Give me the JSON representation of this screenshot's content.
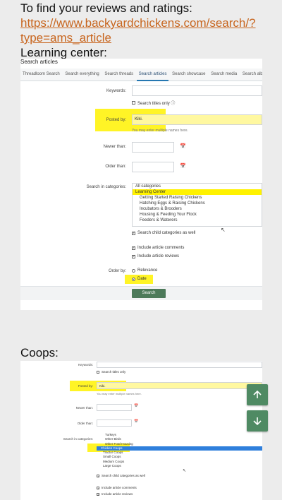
{
  "intro": {
    "line1": "To find your reviews and ratings:",
    "link_line1": "https://www.backyardchickens.com/search/?",
    "link_line2": "type=ams_article",
    "section1": "Learning center:",
    "section2": "Coops:"
  },
  "shot1": {
    "title": "Search articles",
    "tabs": [
      "Threadloom Search",
      "Search everything",
      "Search threads",
      "Search articles",
      "Search showcase",
      "Search media",
      "Search album"
    ],
    "keywords_label": "Keywords:",
    "titles_only": "Search titles only ⓘ",
    "posted_by_label": "Posted by:",
    "posted_by_value": "Kiki.",
    "names_hint": "You may enter multiple names here.",
    "newer_label": "Newer than:",
    "older_label": "Older than:",
    "categories_label": "Search in categories:",
    "categories": [
      {
        "label": "All categories",
        "level": "top",
        "state": ""
      },
      {
        "label": "Learning Center",
        "level": "top",
        "state": "sel"
      },
      {
        "label": "Getting Started Raising Chickens",
        "level": "sub",
        "state": ""
      },
      {
        "label": "Hatching Eggs & Raising Chickens",
        "level": "sub",
        "state": ""
      },
      {
        "label": "Incubators & Brooders",
        "level": "sub",
        "state": ""
      },
      {
        "label": "Housing & Feeding Your Flock",
        "level": "sub",
        "state": ""
      },
      {
        "label": "Feeders & Waterers",
        "level": "sub",
        "state": ""
      }
    ],
    "child_cats": "Search child categories as well",
    "include_comments": "Include article comments",
    "include_reviews": "Include article reviews",
    "order_label": "Order by:",
    "order_relevance": "Relevance",
    "order_date": "Date",
    "search_button": "Search"
  },
  "shot2": {
    "keywords_label": "Keywords:",
    "titles_only": "Search titles only",
    "posted_by_label": "Posted by:",
    "posted_by_value": "Kiki.",
    "names_hint": "You may enter multiple names here.",
    "newer_label": "Newer than:",
    "older_label": "Older than:",
    "categories_label": "Search in categories:",
    "categories": [
      {
        "label": "Turkeys",
        "state": ""
      },
      {
        "label": "Other Birds",
        "state": ""
      },
      {
        "label": "Other Fowl Housing",
        "state": ""
      },
      {
        "label": "Chicken Coops",
        "state": "sel2"
      },
      {
        "label": "Tractor Coops",
        "state": ""
      },
      {
        "label": "Small Coops",
        "state": ""
      },
      {
        "label": "Medium Coops",
        "state": ""
      },
      {
        "label": "Large Coops",
        "state": ""
      }
    ],
    "child_cats": "Search child categories as well",
    "include_comments": "Include article comments",
    "include_reviews": "Include article reviews"
  },
  "scroll_up_icon": "arrow-up-icon",
  "scroll_down_icon": "arrow-down-icon",
  "colors": {
    "link": "#c8661f",
    "highlight": "#fff200",
    "button": "#4d7a5a",
    "fab": "#4f8a63"
  }
}
